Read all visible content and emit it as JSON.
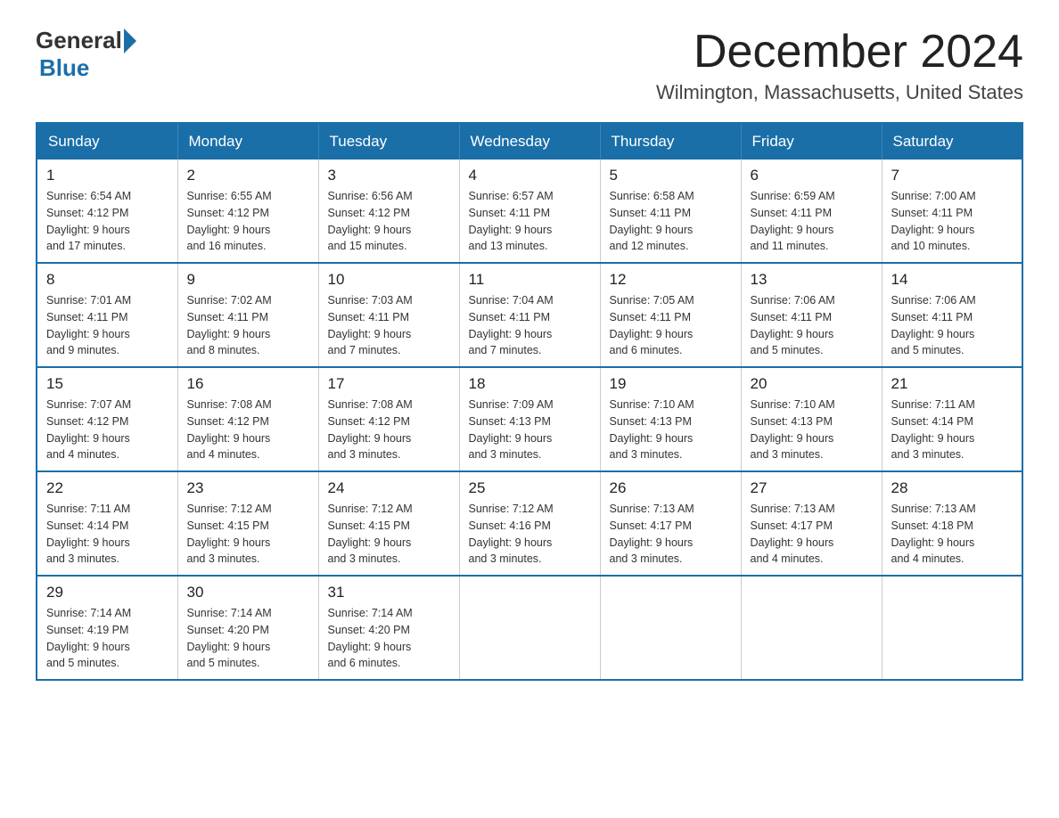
{
  "logo": {
    "general": "General",
    "blue": "Blue"
  },
  "title": "December 2024",
  "subtitle": "Wilmington, Massachusetts, United States",
  "days_of_week": [
    "Sunday",
    "Monday",
    "Tuesday",
    "Wednesday",
    "Thursday",
    "Friday",
    "Saturday"
  ],
  "weeks": [
    [
      {
        "day": "1",
        "sunrise": "6:54 AM",
        "sunset": "4:12 PM",
        "daylight": "9 hours and 17 minutes."
      },
      {
        "day": "2",
        "sunrise": "6:55 AM",
        "sunset": "4:12 PM",
        "daylight": "9 hours and 16 minutes."
      },
      {
        "day": "3",
        "sunrise": "6:56 AM",
        "sunset": "4:12 PM",
        "daylight": "9 hours and 15 minutes."
      },
      {
        "day": "4",
        "sunrise": "6:57 AM",
        "sunset": "4:11 PM",
        "daylight": "9 hours and 13 minutes."
      },
      {
        "day": "5",
        "sunrise": "6:58 AM",
        "sunset": "4:11 PM",
        "daylight": "9 hours and 12 minutes."
      },
      {
        "day": "6",
        "sunrise": "6:59 AM",
        "sunset": "4:11 PM",
        "daylight": "9 hours and 11 minutes."
      },
      {
        "day": "7",
        "sunrise": "7:00 AM",
        "sunset": "4:11 PM",
        "daylight": "9 hours and 10 minutes."
      }
    ],
    [
      {
        "day": "8",
        "sunrise": "7:01 AM",
        "sunset": "4:11 PM",
        "daylight": "9 hours and 9 minutes."
      },
      {
        "day": "9",
        "sunrise": "7:02 AM",
        "sunset": "4:11 PM",
        "daylight": "9 hours and 8 minutes."
      },
      {
        "day": "10",
        "sunrise": "7:03 AM",
        "sunset": "4:11 PM",
        "daylight": "9 hours and 7 minutes."
      },
      {
        "day": "11",
        "sunrise": "7:04 AM",
        "sunset": "4:11 PM",
        "daylight": "9 hours and 7 minutes."
      },
      {
        "day": "12",
        "sunrise": "7:05 AM",
        "sunset": "4:11 PM",
        "daylight": "9 hours and 6 minutes."
      },
      {
        "day": "13",
        "sunrise": "7:06 AM",
        "sunset": "4:11 PM",
        "daylight": "9 hours and 5 minutes."
      },
      {
        "day": "14",
        "sunrise": "7:06 AM",
        "sunset": "4:11 PM",
        "daylight": "9 hours and 5 minutes."
      }
    ],
    [
      {
        "day": "15",
        "sunrise": "7:07 AM",
        "sunset": "4:12 PM",
        "daylight": "9 hours and 4 minutes."
      },
      {
        "day": "16",
        "sunrise": "7:08 AM",
        "sunset": "4:12 PM",
        "daylight": "9 hours and 4 minutes."
      },
      {
        "day": "17",
        "sunrise": "7:08 AM",
        "sunset": "4:12 PM",
        "daylight": "9 hours and 3 minutes."
      },
      {
        "day": "18",
        "sunrise": "7:09 AM",
        "sunset": "4:13 PM",
        "daylight": "9 hours and 3 minutes."
      },
      {
        "day": "19",
        "sunrise": "7:10 AM",
        "sunset": "4:13 PM",
        "daylight": "9 hours and 3 minutes."
      },
      {
        "day": "20",
        "sunrise": "7:10 AM",
        "sunset": "4:13 PM",
        "daylight": "9 hours and 3 minutes."
      },
      {
        "day": "21",
        "sunrise": "7:11 AM",
        "sunset": "4:14 PM",
        "daylight": "9 hours and 3 minutes."
      }
    ],
    [
      {
        "day": "22",
        "sunrise": "7:11 AM",
        "sunset": "4:14 PM",
        "daylight": "9 hours and 3 minutes."
      },
      {
        "day": "23",
        "sunrise": "7:12 AM",
        "sunset": "4:15 PM",
        "daylight": "9 hours and 3 minutes."
      },
      {
        "day": "24",
        "sunrise": "7:12 AM",
        "sunset": "4:15 PM",
        "daylight": "9 hours and 3 minutes."
      },
      {
        "day": "25",
        "sunrise": "7:12 AM",
        "sunset": "4:16 PM",
        "daylight": "9 hours and 3 minutes."
      },
      {
        "day": "26",
        "sunrise": "7:13 AM",
        "sunset": "4:17 PM",
        "daylight": "9 hours and 3 minutes."
      },
      {
        "day": "27",
        "sunrise": "7:13 AM",
        "sunset": "4:17 PM",
        "daylight": "9 hours and 4 minutes."
      },
      {
        "day": "28",
        "sunrise": "7:13 AM",
        "sunset": "4:18 PM",
        "daylight": "9 hours and 4 minutes."
      }
    ],
    [
      {
        "day": "29",
        "sunrise": "7:14 AM",
        "sunset": "4:19 PM",
        "daylight": "9 hours and 5 minutes."
      },
      {
        "day": "30",
        "sunrise": "7:14 AM",
        "sunset": "4:20 PM",
        "daylight": "9 hours and 5 minutes."
      },
      {
        "day": "31",
        "sunrise": "7:14 AM",
        "sunset": "4:20 PM",
        "daylight": "9 hours and 6 minutes."
      },
      null,
      null,
      null,
      null
    ]
  ],
  "labels": {
    "sunrise": "Sunrise:",
    "sunset": "Sunset:",
    "daylight": "Daylight:"
  }
}
